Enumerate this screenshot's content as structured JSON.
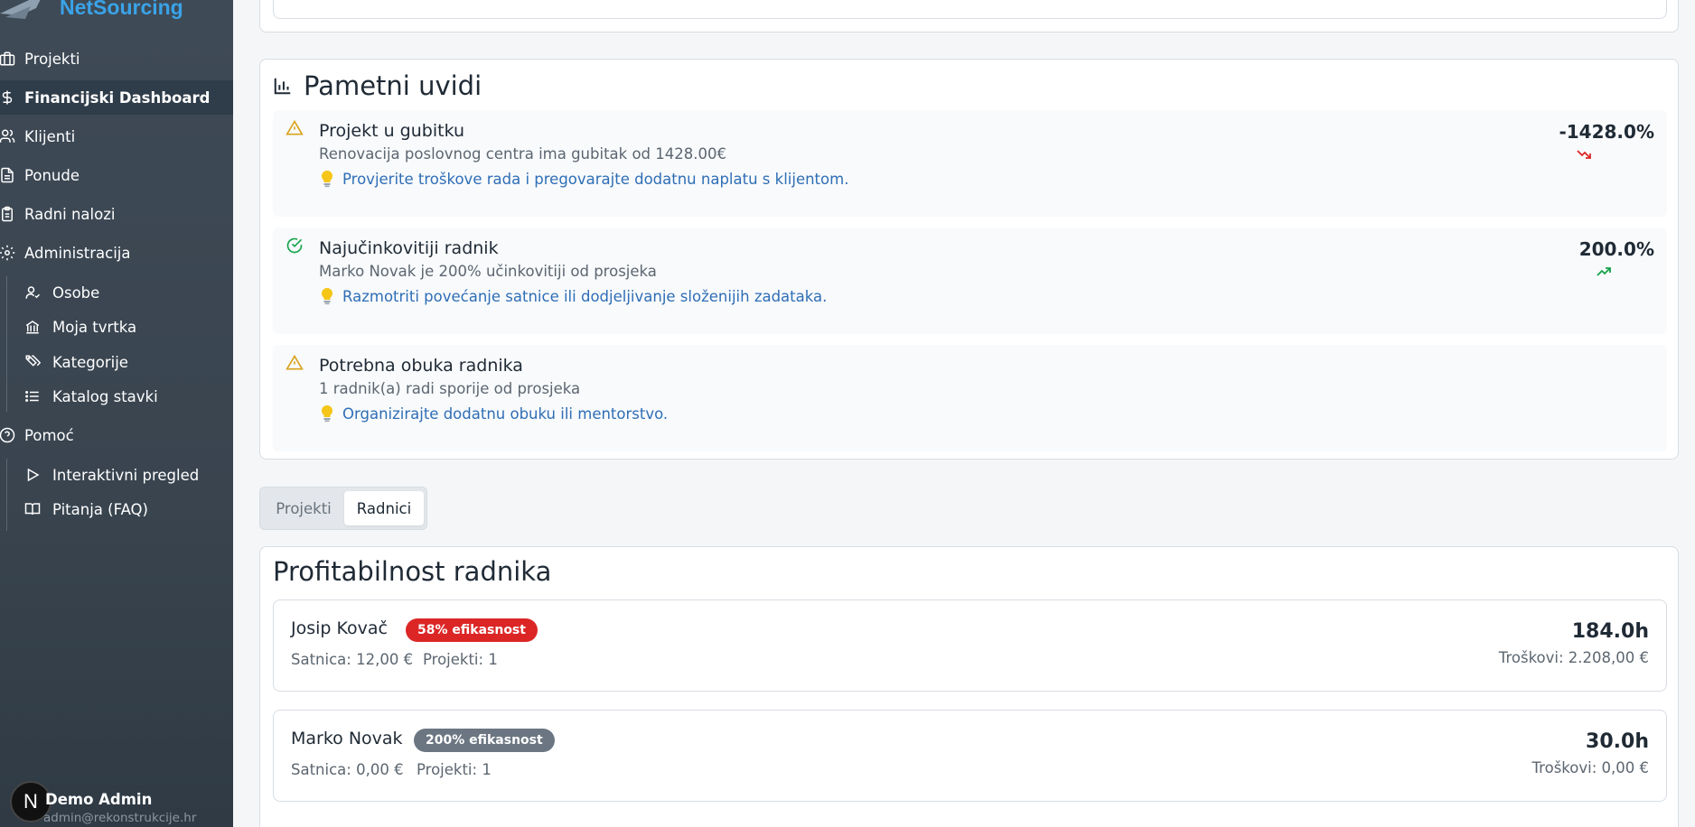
{
  "brand": {
    "name": "NetSourcing"
  },
  "sidebar": {
    "items": [
      {
        "label": "Projekti",
        "icon": "briefcase-icon"
      },
      {
        "label": "Financijski Dashboard",
        "icon": "dollar-icon",
        "active": true
      },
      {
        "label": "Klijenti",
        "icon": "users-icon"
      },
      {
        "label": "Ponude",
        "icon": "document-icon"
      },
      {
        "label": "Radni nalozi",
        "icon": "clipboard-icon"
      },
      {
        "label": "Administracija",
        "icon": "gear-icon"
      }
    ],
    "admin_sub": [
      {
        "label": "Osobe",
        "icon": "user-icon"
      },
      {
        "label": "Moja tvrtka",
        "icon": "bank-icon"
      },
      {
        "label": "Kategorije",
        "icon": "tags-icon"
      },
      {
        "label": "Katalog stavki",
        "icon": "list-icon"
      }
    ],
    "help": {
      "label": "Pomoć",
      "icon": "help-circle-icon"
    },
    "help_sub": [
      {
        "label": "Interaktivni pregled",
        "icon": "play-icon"
      },
      {
        "label": "Pitanja (FAQ)",
        "icon": "book-icon"
      }
    ]
  },
  "user": {
    "avatar_letter": "N",
    "name": "Demo Admin",
    "email": "admin@rekonstrukcije.hr"
  },
  "insights": {
    "title": "Pametni uvidi",
    "items": [
      {
        "type": "warning",
        "title": "Projekt u gubitku",
        "description": "Renovacija poslovnog centra ima gubitak od 1428.00€",
        "tip": "Provjerite troškove rada i pregovarajte dodatnu naplatu s klijentom.",
        "value": "-1428.0%",
        "trend": "down"
      },
      {
        "type": "success",
        "title": "Najučinkovitiji radnik",
        "description": "Marko Novak je 200% učinkovitiji od prosjeka",
        "tip": "Razmotriti povećanje satnice ili dodjeljivanje složenijih zadataka.",
        "value": "200.0%",
        "trend": "up"
      },
      {
        "type": "warning",
        "title": "Potrebna obuka radnika",
        "description": "1 radnik(a) radi sporije od prosjeka",
        "tip": "Organizirajte dodatnu obuku ili mentorstvo.",
        "value": "",
        "trend": ""
      }
    ]
  },
  "tabs": [
    {
      "label": "Projekti",
      "active": false
    },
    {
      "label": "Radnici",
      "active": true
    }
  ],
  "workers": {
    "title": "Profitabilnost radnika",
    "items": [
      {
        "name": "Josip Kovač",
        "badge": "58% efikasnost",
        "badge_color": "#dc2626",
        "rate": "Satnica: 12,00 €",
        "projects": "Projekti: 1",
        "hours": "184.0h",
        "cost": "Troškovi: 2.208,00 €"
      },
      {
        "name": "Marko Novak",
        "badge": "200% efikasnost",
        "badge_color": "#6b7682",
        "rate": "Satnica: 0,00 €",
        "projects": "Projekti: 1",
        "hours": "30.0h",
        "cost": "Troškovi: 0,00 €"
      }
    ]
  },
  "colors": {
    "accent": "#3aa3e8",
    "link": "#2f6eb5",
    "warning": "#d9a21b",
    "success": "#16a34a",
    "danger": "#dc2626"
  }
}
